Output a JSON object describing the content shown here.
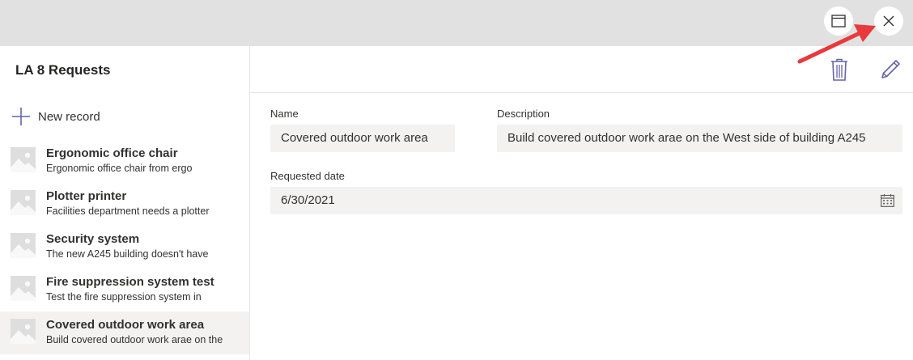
{
  "app": {
    "title": "LA 8 Requests"
  },
  "window_controls": {
    "popout_icon": "window-icon",
    "close_icon": "close-icon"
  },
  "toolbar": {
    "new_record_label": "New record",
    "delete_icon": "trash-icon",
    "edit_icon": "pencil-icon"
  },
  "records": [
    {
      "title": "Ergonomic office chair",
      "subtitle": "Ergonomic office chair from ergo",
      "selected": false
    },
    {
      "title": "Plotter printer",
      "subtitle": "Facilities department needs a plotter",
      "selected": false
    },
    {
      "title": "Security system",
      "subtitle": "The new A245 building doesn't have",
      "selected": false
    },
    {
      "title": "Fire suppression system test",
      "subtitle": "Test the fire suppression system in",
      "selected": false
    },
    {
      "title": "Covered outdoor work area",
      "subtitle": "Build covered outdoor work arae on the",
      "selected": true
    }
  ],
  "detail": {
    "name_label": "Name",
    "name_value": "Covered outdoor work area",
    "description_label": "Description",
    "description_value": "Build covered outdoor work arae on the West side of building A245",
    "date_label": "Requested date",
    "date_value": "6/30/2021",
    "date_icon": "calendar-icon"
  },
  "colors": {
    "accent": "#6264a7",
    "annotation_arrow": "#e8393c",
    "topbar": "#e1e1e1",
    "field_bg": "#f3f2f1"
  }
}
